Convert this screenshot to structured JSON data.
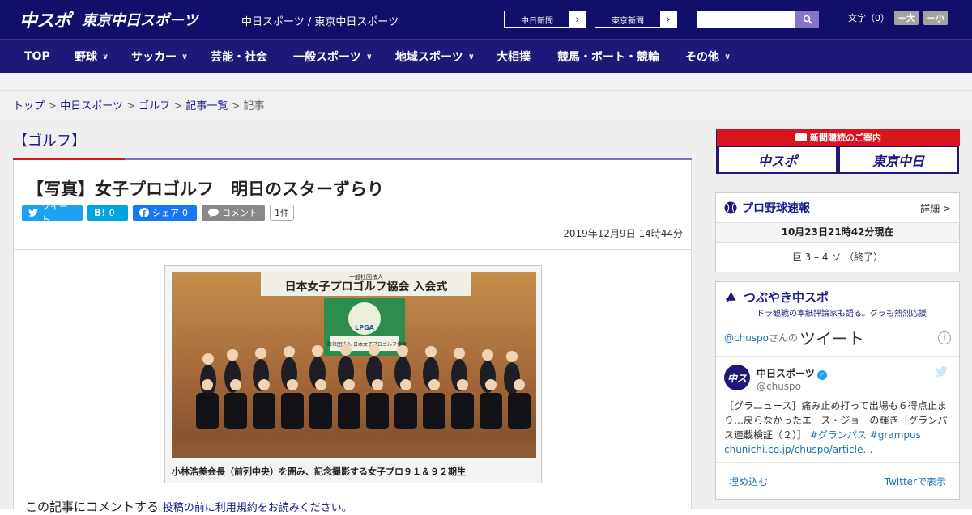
{
  "header": {
    "logo_primary": "中スポ",
    "logo_secondary": "東京中日スポーツ",
    "site_name": "中日スポーツ / 東京中日スポーツ",
    "news_buttons": [
      "中日新聞",
      "東京新聞"
    ],
    "search_placeholder": "",
    "fontsize_label": "文字（0）",
    "fontsize_plus": "＋大",
    "fontsize_minus": "－小"
  },
  "nav": {
    "items": [
      {
        "label": "TOP",
        "has_menu": false
      },
      {
        "label": "野球",
        "has_menu": true
      },
      {
        "label": "サッカー",
        "has_menu": true
      },
      {
        "label": "芸能・社会",
        "has_menu": false
      },
      {
        "label": "一般スポーツ",
        "has_menu": true
      },
      {
        "label": "地域スポーツ",
        "has_menu": true
      },
      {
        "label": "大相撲",
        "has_menu": false
      },
      {
        "label": "競馬・ボート・競輪",
        "has_menu": false
      },
      {
        "label": "その他",
        "has_menu": true
      }
    ]
  },
  "breadcrumb": {
    "items": [
      "トップ",
      "中日スポーツ",
      "ゴルフ",
      "記事一覧"
    ],
    "current": "記事",
    "separator": ">"
  },
  "category": "【ゴルフ】",
  "article": {
    "title": "【写真】女子プロゴルフ　明日のスターずらり",
    "share": {
      "tweet": "ツイート",
      "hatena_label": "B!",
      "hatena_count": "0",
      "facebook": "シェア",
      "facebook_count": "0",
      "comment": "コメント",
      "comment_count": "1件"
    },
    "date": "2019年12月9日 14時44分",
    "photo": {
      "banner_small": "一般社団法人",
      "banner_text": "日本女子プロゴルフ協会 入会式",
      "flag_logo": "LPGA",
      "flag_text": "一般社団法人 日本女子プロゴルフ協会",
      "caption": "小林浩美会長（前列中央）を囲み、記念撮影する女子プロ９１＆９２期生"
    },
    "comment_prompt": "この記事にコメントする",
    "comment_link": "投稿の前に利用規約をお読みください。"
  },
  "sidebar": {
    "subscribe": {
      "header": "新聞購読のご案内",
      "logo1": "中スポ",
      "logo2": "東京中日"
    },
    "baseball": {
      "title": "プロ野球速報",
      "detail": "詳細 >",
      "time": "10月23日21時42分現在",
      "score": "巨 3 – 4 ソ （終了）"
    },
    "tweets": {
      "title": "つぶやき中スポ",
      "subtitle": "ドラ観戦の本紙評論家も語る。グラも熱烈応援",
      "handle_at": "@chuspo",
      "handle_suffix": "さんの",
      "big_label": "ツイート",
      "info": "i",
      "account_name": "中日スポーツ",
      "account_handle": "@chuspo",
      "text_main": "［グラニュース］痛み止め打って出場も６得点止まり…戻らなかったエース・ジョーの輝き［グランパス連載検証（２）］",
      "hashtag1": "#グランパス",
      "hashtag2": "#grampus",
      "link": "chunichi.co.jp/chuspo/article…",
      "embed": "埋め込む",
      "view_on": "Twitterで表示"
    }
  },
  "colors": {
    "header_bg": "#120f6b",
    "nav_bg": "#1e1978",
    "accent_red": "#d8141f",
    "link": "#1b1d8a"
  }
}
